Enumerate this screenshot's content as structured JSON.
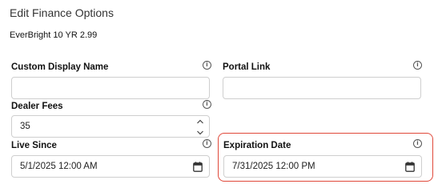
{
  "dialog": {
    "title": "Edit Finance Options",
    "product_name": "EverBright 10 YR 2.99"
  },
  "fields": {
    "custom_display_name": {
      "label": "Custom Display Name",
      "value": ""
    },
    "portal_link": {
      "label": "Portal Link",
      "value": ""
    },
    "dealer_fees": {
      "label": "Dealer Fees",
      "value": "35"
    },
    "live_since": {
      "label": "Live Since",
      "value": "5/1/2025 12:00 AM"
    },
    "expiration_date": {
      "label": "Expiration Date",
      "value": "7/31/2025 12:00 PM"
    }
  },
  "icons": {
    "info": "info-icon",
    "calendar": "calendar-icon",
    "spinner": "number-spinner-icon"
  },
  "colors": {
    "highlight": "#e0483a"
  }
}
